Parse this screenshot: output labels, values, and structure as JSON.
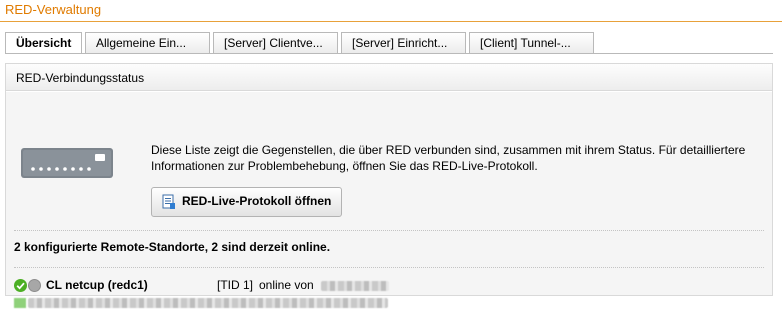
{
  "header": {
    "title": "RED-Verwaltung"
  },
  "tabs": [
    {
      "label": "Übersicht",
      "active": true
    },
    {
      "label": "Allgemeine Ein...",
      "active": false
    },
    {
      "label": "[Server] Clientve...",
      "active": false
    },
    {
      "label": "[Server] Einricht...",
      "active": false
    },
    {
      "label": "[Client] Tunnel-...",
      "active": false
    }
  ],
  "panel": {
    "title": "RED-Verbindungsstatus",
    "description": "Diese Liste zeigt die Gegenstellen, die über RED verbunden sind, zusammen mit ihrem Status. Für detailliertere Informationen zur Problembehebung, öffnen Sie das RED-Live-Protokoll.",
    "live_button_label": "RED-Live-Protokoll öffnen",
    "summary": "2 konfigurierte Remote-Standorte, 2 sind derzeit online.",
    "sites": [
      {
        "name": "CL netcup (redc1)",
        "tid": "[TID 1]",
        "status_text": "online von",
        "status_color": "#4caf24"
      }
    ]
  },
  "colors": {
    "accent": "#e07b00",
    "online": "#4caf24"
  },
  "icons": {
    "device": "red-device-icon",
    "status_online": "status-online-icon",
    "status_unknown": "status-gray-icon",
    "button_icon": "log-document-icon"
  }
}
